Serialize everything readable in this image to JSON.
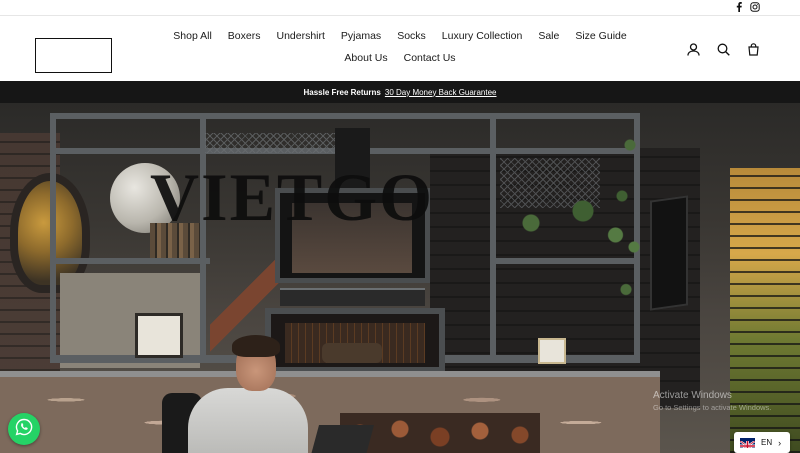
{
  "topbar": {
    "social": [
      {
        "icon": "facebook-icon",
        "glyph": "f"
      },
      {
        "icon": "instagram-icon",
        "glyph": "◎"
      }
    ]
  },
  "header": {
    "nav": [
      {
        "label": "Shop All"
      },
      {
        "label": "Boxers"
      },
      {
        "label": "Undershirt"
      },
      {
        "label": "Pyjamas"
      },
      {
        "label": "Socks"
      },
      {
        "label": "Luxury Collection"
      },
      {
        "label": "Sale"
      },
      {
        "label": "Size Guide"
      },
      {
        "label": "About Us"
      },
      {
        "label": "Contact Us"
      }
    ],
    "icons": [
      "account-icon",
      "search-icon",
      "cart-icon"
    ]
  },
  "announcement": {
    "bold_text": "Hassle Free Returns",
    "link_text": "30 Day Money Back Guarantee"
  },
  "hero": {
    "brand": "VIETGO"
  },
  "activation_watermark": {
    "title": "Activate Windows",
    "subtitle": "Go to Settings to activate Windows."
  },
  "language": {
    "code": "EN",
    "flag_icon": "uk-flag-icon"
  },
  "colors": {
    "announcement_bg": "#161616",
    "whatsapp": "#25d366"
  }
}
